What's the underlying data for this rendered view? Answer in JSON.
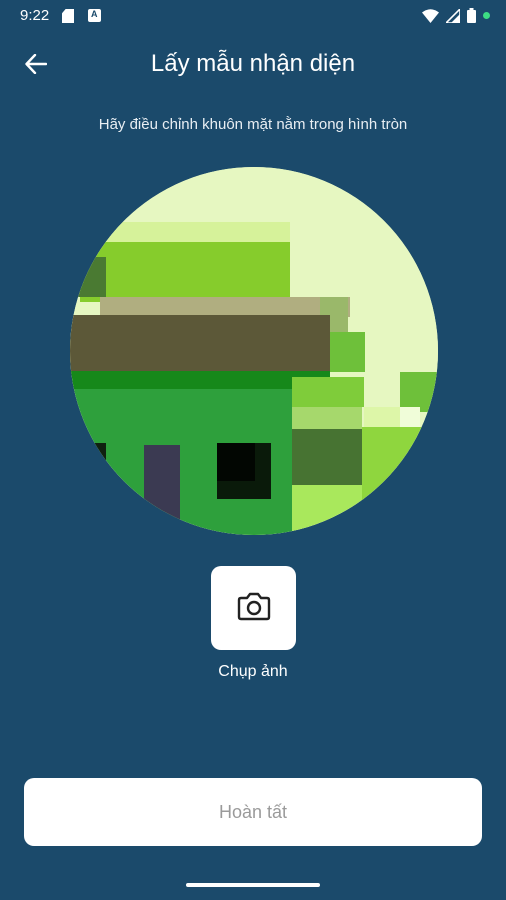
{
  "status_bar": {
    "time": "9:22",
    "left_icons": [
      "sd-card-icon",
      "text-a-icon"
    ],
    "right_icons": [
      "wifi-icon",
      "signal-icon",
      "battery-icon",
      "notification-dot-icon"
    ]
  },
  "header": {
    "title": "Lấy mẫu nhận diện",
    "back_icon": "arrow-left-icon"
  },
  "instruction": "Hãy điều chỉnh khuôn mặt nằm trong hình tròn",
  "capture": {
    "icon": "camera-icon",
    "label": "Chụp ảnh"
  },
  "finish_button": {
    "label": "Hoàn tất",
    "enabled": false
  },
  "colors": {
    "background": "#1b4a6b",
    "button_bg": "#ffffff",
    "disabled_text": "#9a9a9a",
    "status_dot": "#3ddc84"
  }
}
